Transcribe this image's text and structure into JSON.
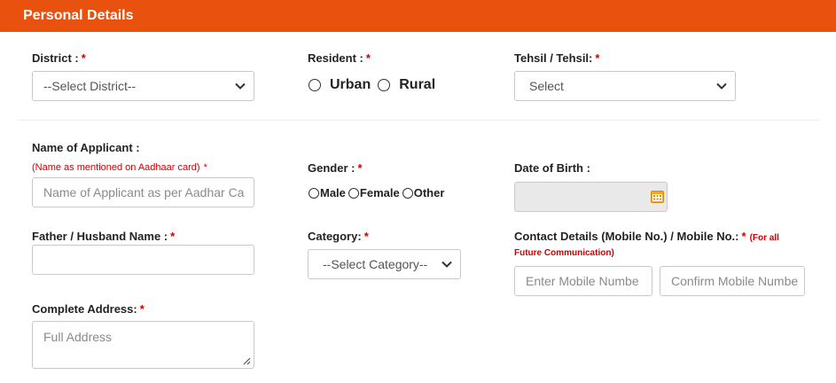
{
  "header": {
    "title": "Personal Details"
  },
  "district": {
    "label": "District :",
    "required": "*",
    "value": "--Select District--"
  },
  "resident": {
    "label": "Resident :",
    "required": "*",
    "options": [
      "Urban",
      "Rural"
    ]
  },
  "tehsil": {
    "label": "Tehsil / Tehsil:",
    "required": "*",
    "value": "Select"
  },
  "applicant": {
    "label": "Name of Applicant :",
    "note": "(Name as mentioned on Aadhaar card)",
    "required": "*",
    "placeholder": "Name of Applicant as per Aadhar Ca"
  },
  "gender": {
    "label": "Gender :",
    "required": "*",
    "options": [
      "Male",
      "Female",
      "Other"
    ]
  },
  "dob": {
    "label": "Date of Birth :"
  },
  "father": {
    "label": "Father / Husband Name :",
    "required": "*"
  },
  "category": {
    "label": "Category:",
    "required": "*",
    "value": "--Select Category--"
  },
  "contact": {
    "label": "Contact Details (Mobile No.) / Mobile No.:",
    "required": "*",
    "note_line1": "(For all",
    "note_line2": "Future Communication)",
    "mobile_placeholder": "Enter Mobile Numbe",
    "confirm_placeholder": "Confirm Mobile Numbe"
  },
  "address": {
    "label": "Complete Address:",
    "required": "*",
    "placeholder": "Full Address"
  }
}
